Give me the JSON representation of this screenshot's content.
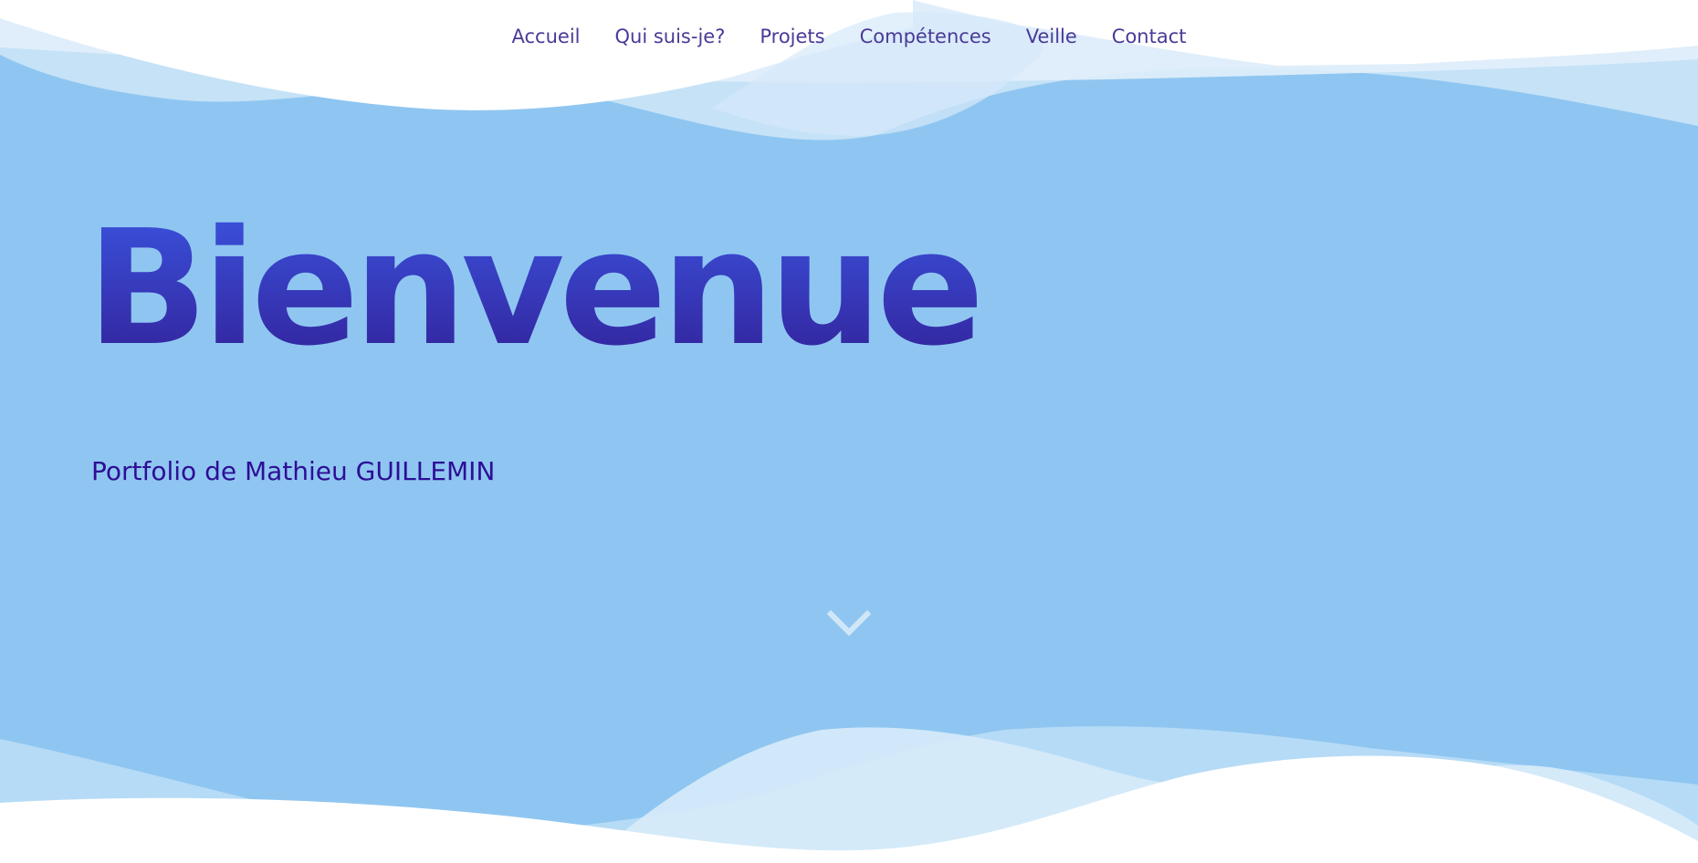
{
  "nav": {
    "items": [
      {
        "label": "Accueil"
      },
      {
        "label": "Qui suis-je?"
      },
      {
        "label": "Projets"
      },
      {
        "label": "Compétences"
      },
      {
        "label": "Veille"
      },
      {
        "label": "Contact"
      }
    ]
  },
  "hero": {
    "title": "Bienvenue",
    "subtitle": "Portfolio de Mathieu GUILLEMIN",
    "scroll_icon": "chevron-down-icon"
  },
  "colors": {
    "background": "#8fc6f1",
    "nav_text": "#4a3a98",
    "title_top": "#3a52dc",
    "title_bottom": "#33229a",
    "subtitle": "#2d0e96",
    "wave_white": "#ffffff",
    "wave_light": "#d3e8f8"
  }
}
